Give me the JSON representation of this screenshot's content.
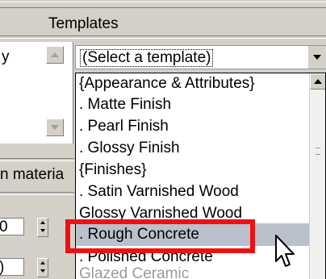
{
  "header": {
    "title": "Templates"
  },
  "left_panel": {
    "partial_text": "y",
    "label_partial": "n materia",
    "spinner_values": [
      "0",
      ")"
    ]
  },
  "combo": {
    "value": "(Select a template)"
  },
  "list": {
    "items": [
      {
        "label": "{Appearance & Attributes}"
      },
      {
        "label": ".  Matte Finish"
      },
      {
        "label": ".  Pearl Finish"
      },
      {
        "label": ".  Glossy Finish"
      },
      {
        "label": "{Finishes}"
      },
      {
        "label": ".  Satin Varnished Wood"
      },
      {
        "label": "   Glossy Varnished Wood"
      },
      {
        "label": ".  Rough Concrete",
        "selected": true
      },
      {
        "label": ".  Polished Concrete"
      },
      {
        "label": "   Glazed Ceramic"
      }
    ]
  },
  "colors": {
    "highlight": "#ee1111",
    "selection": "#b9c1cd"
  }
}
